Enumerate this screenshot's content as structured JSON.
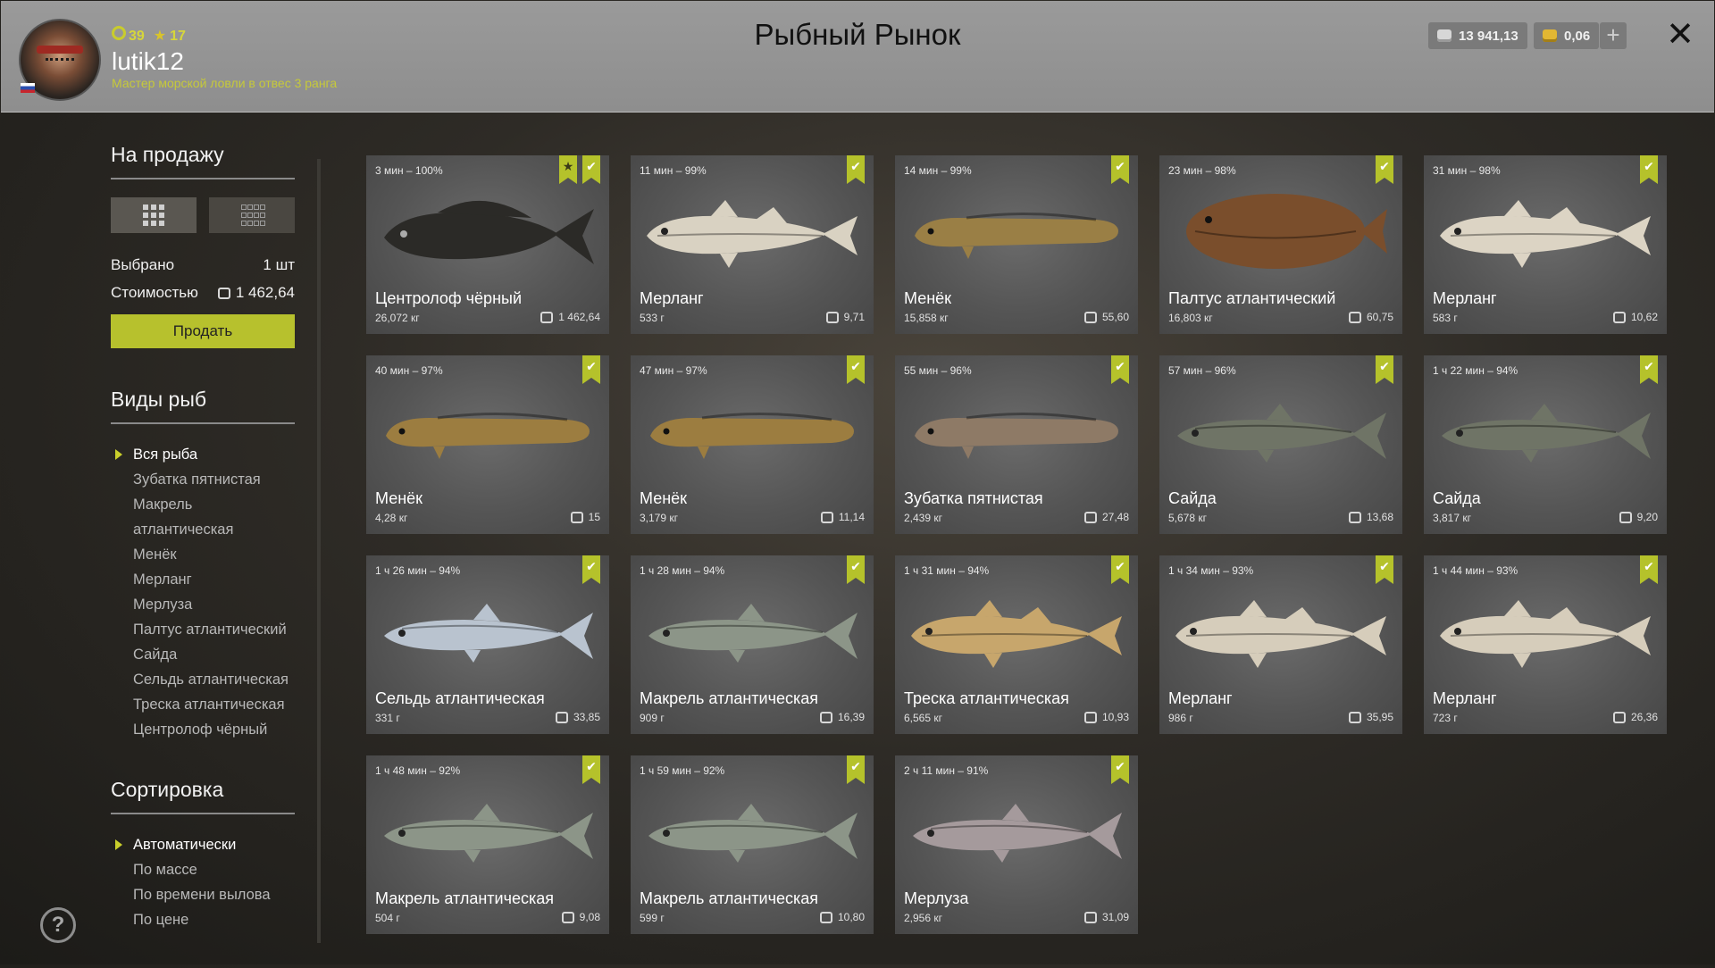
{
  "header": {
    "title": "Рыбный Рынок",
    "player": {
      "level": "39",
      "stars": "17",
      "username": "lutik12",
      "rank": "Мастер морской ловли в отвес 3 ранга"
    },
    "silver": "13 941,13",
    "gold": "0,06",
    "plus_label": "+",
    "close_label": "✕"
  },
  "sidebar": {
    "for_sale_title": "На продажу",
    "selected_label": "Выбрано",
    "selected_value": "1 шт",
    "cost_label": "Стоимостью",
    "cost_value": "1 462,64",
    "sell_button": "Продать",
    "species_title": "Виды рыб",
    "species": [
      "Вся рыба",
      "Зубатка пятнистая",
      "Макрель атлантическая",
      "Менёк",
      "Мерланг",
      "Мерлуза",
      "Палтус атлантический",
      "Сайда",
      "Сельдь атлантическая",
      "Треска атлантическая",
      "Центролоф чёрный"
    ],
    "species_selected": 0,
    "sort_title": "Сортировка",
    "sort_options": [
      "Автоматически",
      "По массе",
      "По времени вылова",
      "По цене"
    ],
    "sort_selected": 0,
    "help_label": "?"
  },
  "fish": [
    {
      "time": "3 мин – 100%",
      "name": "Центролоф чёрный",
      "weight": "26,072 кг",
      "price": "1 462,64",
      "star": true,
      "fish_color": "#2b2a27",
      "shape": "perch"
    },
    {
      "time": "11 мин – 99%",
      "name": "Мерланг",
      "weight": "533 г",
      "price": "9,71",
      "star": false,
      "fish_color": "#d9d2c2",
      "shape": "cod"
    },
    {
      "time": "14 мин – 99%",
      "name": "Менёк",
      "weight": "15,858 кг",
      "price": "55,60",
      "star": false,
      "fish_color": "#9a7f45",
      "shape": "eel"
    },
    {
      "time": "23 мин – 98%",
      "name": "Палтус атлантический",
      "weight": "16,803 кг",
      "price": "60,75",
      "star": false,
      "fish_color": "#7a4e2c",
      "shape": "flat"
    },
    {
      "time": "31 мин – 98%",
      "name": "Мерланг",
      "weight": "583 г",
      "price": "10,62",
      "star": false,
      "fish_color": "#dcd4c4",
      "shape": "cod"
    },
    {
      "time": "40 мин – 97%",
      "name": "Менёк",
      "weight": "4,28 кг",
      "price": "15",
      "star": false,
      "fish_color": "#9c7d40",
      "shape": "eel"
    },
    {
      "time": "47 мин – 97%",
      "name": "Менёк",
      "weight": "3,179 кг",
      "price": "11,14",
      "star": false,
      "fish_color": "#9c7d40",
      "shape": "eel"
    },
    {
      "time": "55 мин – 96%",
      "name": "Зубатка пятнистая",
      "weight": "2,439 кг",
      "price": "27,48",
      "star": false,
      "fish_color": "#8e7a66",
      "shape": "eel"
    },
    {
      "time": "57 мин – 96%",
      "name": "Сайда",
      "weight": "5,678 кг",
      "price": "13,68",
      "star": false,
      "fish_color": "#6f7466",
      "shape": "slim"
    },
    {
      "time": "1 ч 22 мин – 94%",
      "name": "Сайда",
      "weight": "3,817 кг",
      "price": "9,20",
      "star": false,
      "fish_color": "#6f7466",
      "shape": "slim"
    },
    {
      "time": "1 ч 26 мин – 94%",
      "name": "Сельдь атлантическая",
      "weight": "331 г",
      "price": "33,85",
      "star": false,
      "fish_color": "#b9c3cf",
      "shape": "slim"
    },
    {
      "time": "1 ч 28 мин – 94%",
      "name": "Макрель атлантическая",
      "weight": "909 г",
      "price": "16,39",
      "star": false,
      "fish_color": "#8c9588",
      "shape": "slim"
    },
    {
      "time": "1 ч 31 мин – 94%",
      "name": "Треска атлантическая",
      "weight": "6,565 кг",
      "price": "10,93",
      "star": false,
      "fish_color": "#c7a66c",
      "shape": "cod"
    },
    {
      "time": "1 ч 34 мин – 93%",
      "name": "Мерланг",
      "weight": "986 г",
      "price": "35,95",
      "star": false,
      "fish_color": "#d6cdbb",
      "shape": "cod"
    },
    {
      "time": "1 ч 44 мин – 93%",
      "name": "Мерланг",
      "weight": "723 г",
      "price": "26,36",
      "star": false,
      "fish_color": "#d6cdbb",
      "shape": "cod"
    },
    {
      "time": "1 ч 48 мин – 92%",
      "name": "Макрель атлантическая",
      "weight": "504 г",
      "price": "9,08",
      "star": false,
      "fish_color": "#8c9588",
      "shape": "slim"
    },
    {
      "time": "1 ч 59 мин – 92%",
      "name": "Макрель атлантическая",
      "weight": "599 г",
      "price": "10,80",
      "star": false,
      "fish_color": "#8c9588",
      "shape": "slim"
    },
    {
      "time": "2 ч 11 мин – 91%",
      "name": "Мерлуза",
      "weight": "2,956 кг",
      "price": "31,09",
      "star": false,
      "fish_color": "#a59a9c",
      "shape": "slim"
    }
  ],
  "colors": {
    "accent": "#b7c12d",
    "header_bg": "#939393"
  }
}
